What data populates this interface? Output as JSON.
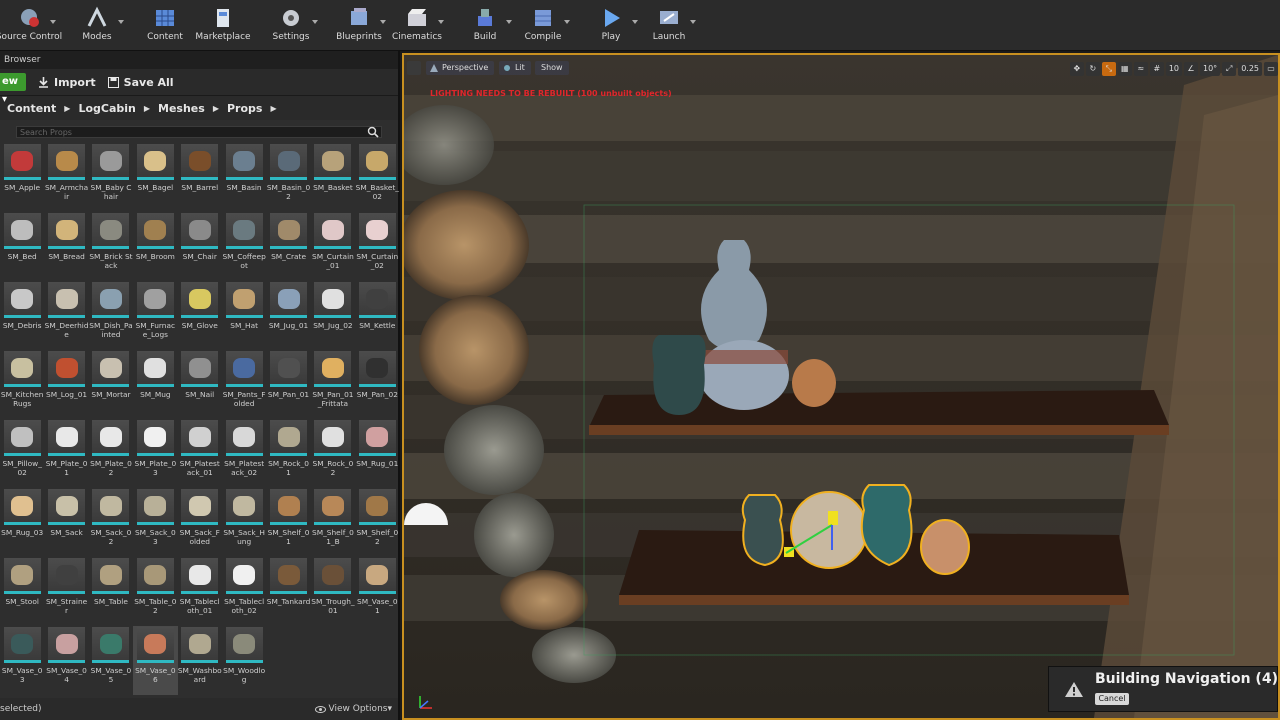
{
  "toolbar": {
    "items": [
      {
        "label": "Source Control",
        "icon": "source-control-icon"
      },
      {
        "label": "Modes",
        "icon": "modes-icon"
      },
      {
        "label": "Content",
        "icon": "content-icon"
      },
      {
        "label": "Marketplace",
        "icon": "marketplace-icon"
      },
      {
        "label": "Settings",
        "icon": "settings-icon"
      },
      {
        "label": "Blueprints",
        "icon": "blueprints-icon"
      },
      {
        "label": "Cinematics",
        "icon": "cinematics-icon"
      },
      {
        "label": "Build",
        "icon": "build-icon"
      },
      {
        "label": "Compile",
        "icon": "compile-icon"
      },
      {
        "label": "Play",
        "icon": "play-icon"
      },
      {
        "label": "Launch",
        "icon": "launch-icon"
      }
    ]
  },
  "content_browser": {
    "tab_label": "Browser",
    "new_label": "ew",
    "import_label": "Import",
    "save_all_label": "Save All",
    "breadcrumbs": [
      "Content",
      "LogCabin",
      "Meshes",
      "Props"
    ],
    "search_placeholder": "Search Props",
    "status": "selected)",
    "view_options": "View Options",
    "assets": [
      {
        "name": "SM_Apple",
        "color": "#c23a3a"
      },
      {
        "name": "SM_Armchair",
        "color": "#b88a4a"
      },
      {
        "name": "SM_Baby Chair",
        "color": "#9a9a9a"
      },
      {
        "name": "SM_Bagel",
        "color": "#d9c08a"
      },
      {
        "name": "SM_Barrel",
        "color": "#7a4e2a"
      },
      {
        "name": "SM_Basin",
        "color": "#6b7f90"
      },
      {
        "name": "SM_Basin_02",
        "color": "#5a6a78"
      },
      {
        "name": "SM_Basket",
        "color": "#b7a27a"
      },
      {
        "name": "SM_Basket_02",
        "color": "#c7a86a"
      },
      {
        "name": "SM_Bed",
        "color": "#bdbdbd"
      },
      {
        "name": "SM_Bread",
        "color": "#d2b47a"
      },
      {
        "name": "SM_Brick Stack",
        "color": "#8a8a80"
      },
      {
        "name": "SM_Broom",
        "color": "#a08050"
      },
      {
        "name": "SM_Chair",
        "color": "#8a8a8a"
      },
      {
        "name": "SM_Coffeepot",
        "color": "#6a7a80"
      },
      {
        "name": "SM_Crate",
        "color": "#a08a6a"
      },
      {
        "name": "SM_Curtain_01",
        "color": "#e0c8c8"
      },
      {
        "name": "SM_Curtain_02",
        "color": "#e8d0d0"
      },
      {
        "name": "SM_Debris",
        "color": "#c8c8c8"
      },
      {
        "name": "SM_Deerhide",
        "color": "#c8c0b0"
      },
      {
        "name": "SM_Dish_Painted",
        "color": "#8aa0b0"
      },
      {
        "name": "SM_Furnace_Logs",
        "color": "#a0a0a0"
      },
      {
        "name": "SM_Glove",
        "color": "#d8c860"
      },
      {
        "name": "SM_Hat",
        "color": "#c0a070"
      },
      {
        "name": "SM_Jug_01",
        "color": "#8aa0b8"
      },
      {
        "name": "SM_Jug_02",
        "color": "#e0e0e0"
      },
      {
        "name": "SM_Kettle",
        "color": "#404040"
      },
      {
        "name": "SM_Kitchen Rugs",
        "color": "#c8c0a0"
      },
      {
        "name": "SM_Log_01",
        "color": "#c05030"
      },
      {
        "name": "SM_Mortar",
        "color": "#c8c0b0"
      },
      {
        "name": "SM_Mug",
        "color": "#e0e0e0"
      },
      {
        "name": "SM_Nail",
        "color": "#909090"
      },
      {
        "name": "SM_Pants_Folded",
        "color": "#4a6aa0"
      },
      {
        "name": "SM_Pan_01",
        "color": "#505050"
      },
      {
        "name": "SM_Pan_01_Frittata",
        "color": "#e0b060"
      },
      {
        "name": "SM_Pan_02",
        "color": "#303030"
      },
      {
        "name": "SM_Pillow_02",
        "color": "#c0c0c0"
      },
      {
        "name": "SM_Plate_01",
        "color": "#e8e8e8"
      },
      {
        "name": "SM_Plate_02",
        "color": "#e8e8e8"
      },
      {
        "name": "SM_Plate_03",
        "color": "#f0f0f0"
      },
      {
        "name": "SM_Platestack_01",
        "color": "#d0d0d0"
      },
      {
        "name": "SM_Platestack_02",
        "color": "#d8d8d8"
      },
      {
        "name": "SM_Rock_01",
        "color": "#b0a890"
      },
      {
        "name": "SM_Rock_02",
        "color": "#e0e0e0"
      },
      {
        "name": "SM_Rug_01",
        "color": "#d0a0a0"
      },
      {
        "name": "SM_Rug_03",
        "color": "#e0c090"
      },
      {
        "name": "SM_Sack",
        "color": "#c8c0a8"
      },
      {
        "name": "SM_Sack_02",
        "color": "#c0b8a0"
      },
      {
        "name": "SM_Sack_03",
        "color": "#b8b098"
      },
      {
        "name": "SM_Sack_Folded",
        "color": "#d0c8b0"
      },
      {
        "name": "SM_Sack_Hung",
        "color": "#c0b8a0"
      },
      {
        "name": "SM_Shelf_01",
        "color": "#b08050"
      },
      {
        "name": "SM_Shelf_01_B",
        "color": "#b88858"
      },
      {
        "name": "SM_Shelf_02",
        "color": "#a07848"
      },
      {
        "name": "SM_Stool",
        "color": "#b0a080"
      },
      {
        "name": "SM_Strainer",
        "color": "#404040"
      },
      {
        "name": "SM_Table",
        "color": "#b0a080"
      },
      {
        "name": "SM_Table_02",
        "color": "#a89878"
      },
      {
        "name": "SM_Tablecloth_01",
        "color": "#e8e8e8"
      },
      {
        "name": "SM_Tablecloth_02",
        "color": "#f0f0f0"
      },
      {
        "name": "SM_Tankard",
        "color": "#7a5a3a"
      },
      {
        "name": "SM_Trough_01",
        "color": "#6a5038"
      },
      {
        "name": "SM_Vase_01",
        "color": "#c8a880"
      },
      {
        "name": "SM_Vase_03",
        "color": "#3a5a5a"
      },
      {
        "name": "SM_Vase_04",
        "color": "#c8a0a0"
      },
      {
        "name": "SM_Vase_05",
        "color": "#3a7a6a"
      },
      {
        "name": "SM_Vase_06",
        "color": "#c87a5a"
      },
      {
        "name": "SM_Washboard",
        "color": "#b0a890"
      },
      {
        "name": "SM_Woodlog",
        "color": "#8a8a7a"
      }
    ],
    "selected_index": 66
  },
  "viewport": {
    "perspective_label": "Perspective",
    "lit_label": "Lit",
    "show_label": "Show",
    "warning": "LIGHTING NEEDS TO BE REBUILT (100 unbuilt objects)",
    "grid_snap": "10",
    "rotation_snap": "10°",
    "scale_snap": "0.25",
    "toast_title": "Building Navigation (4)",
    "toast_cancel": "Cancel"
  },
  "colors": {
    "accent_teal": "#2fb9c2",
    "new_green": "#3c9a2e",
    "viewport_border": "#c89020",
    "warning_red": "#e0262b"
  }
}
